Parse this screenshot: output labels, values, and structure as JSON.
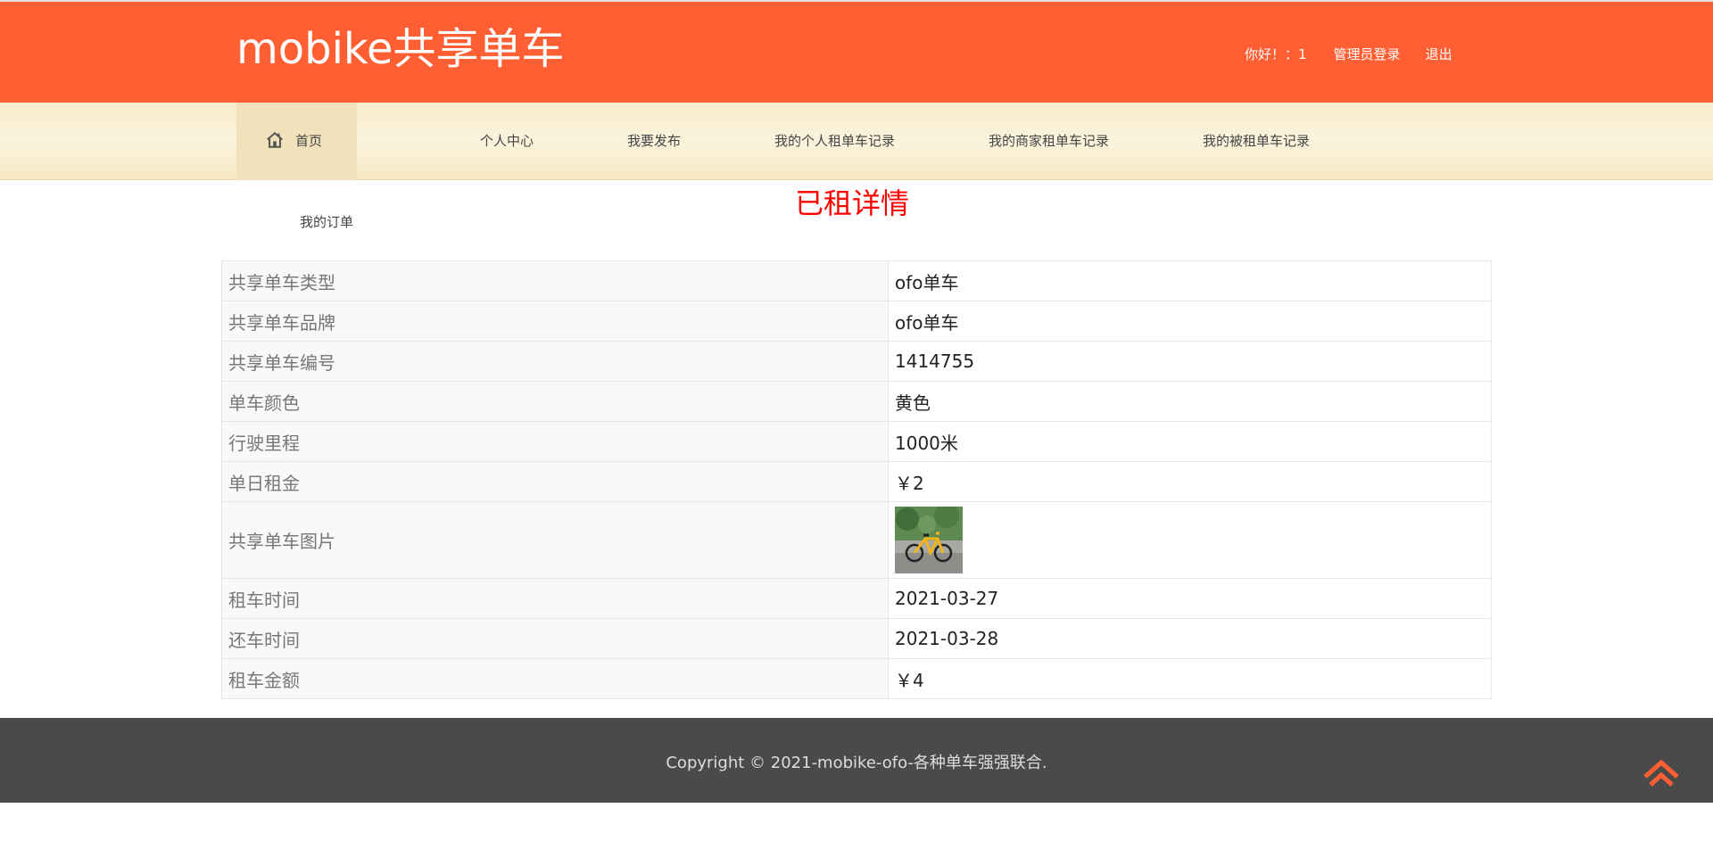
{
  "header": {
    "logo": "mobike共享单车",
    "greeting": "你好！：1",
    "admin_login": "管理员登录",
    "logout": "退出"
  },
  "nav": {
    "items": [
      {
        "label": "首页",
        "icon": "home-icon"
      },
      {
        "label": "个人中心"
      },
      {
        "label": "我要发布"
      },
      {
        "label": "我的个人租单车记录"
      },
      {
        "label": "我的商家租单车记录"
      },
      {
        "label": "我的被租单车记录"
      },
      {
        "label": "我的订单"
      }
    ]
  },
  "page": {
    "title": "已租详情"
  },
  "details": [
    {
      "label": "共享单车类型",
      "value": "ofo单车"
    },
    {
      "label": "共享单车品牌",
      "value": "ofo单车"
    },
    {
      "label": "共享单车编号",
      "value": "1414755"
    },
    {
      "label": "单车颜色",
      "value": "黄色"
    },
    {
      "label": "行驶里程",
      "value": "1000米"
    },
    {
      "label": "单日租金",
      "value": "￥2"
    },
    {
      "label": "共享单车图片",
      "value": ""
    },
    {
      "label": "租车时间",
      "value": "2021-03-27"
    },
    {
      "label": "还车时间",
      "value": "2021-03-28"
    },
    {
      "label": "租车金额",
      "value": "￥4"
    }
  ],
  "footer": {
    "copyright": "Copyright © 2021-mobike-ofo-各种单车强强联合."
  },
  "colors": {
    "header_bg": "#ff5f33",
    "title_red": "#ff0000",
    "footer_bg": "#4a4a4a"
  }
}
